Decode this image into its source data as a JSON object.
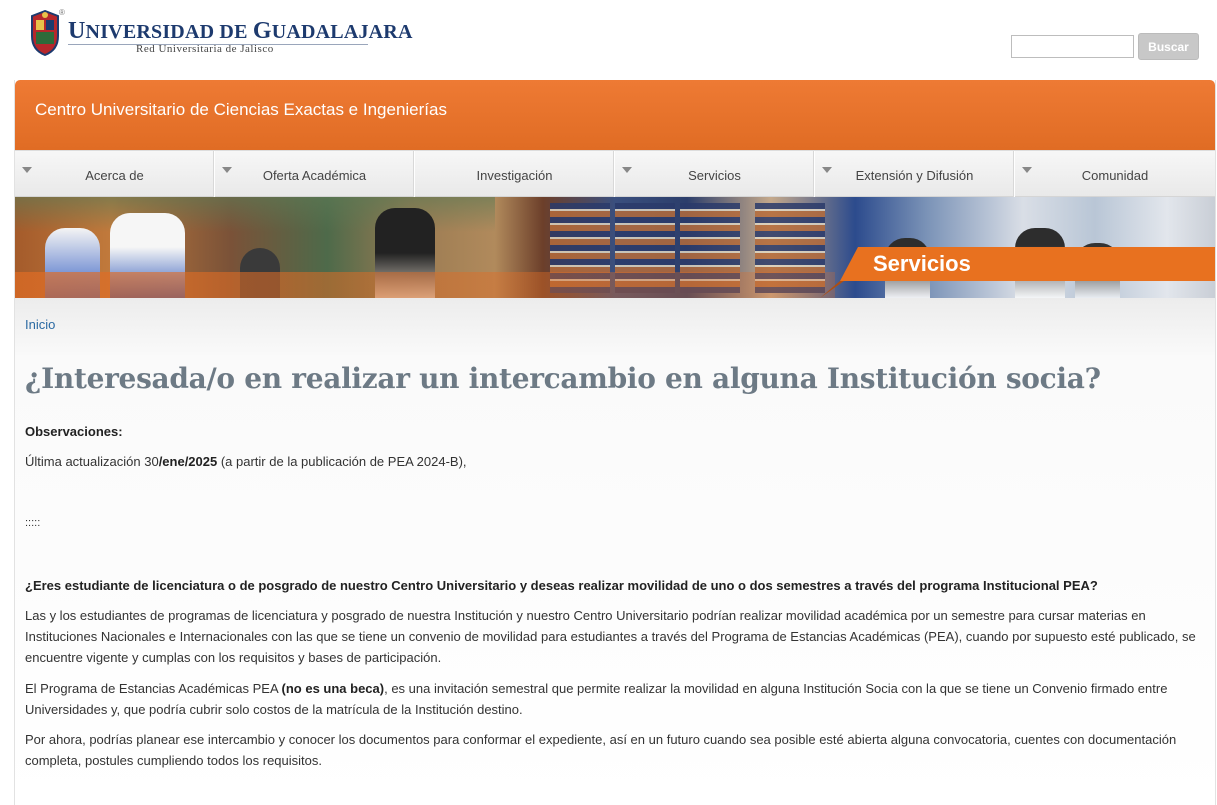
{
  "brand": {
    "title_prefix_big": "U",
    "title_part1": "NIVERSIDAD DE ",
    "title_prefix_big2": "G",
    "title_part2": "UADALAJARA",
    "subtitle": "Red Universitaria de Jalisco",
    "registered": "®"
  },
  "search": {
    "value": "",
    "button_label": "Buscar"
  },
  "header": {
    "title": "Centro Universitario de Ciencias Exactas e Ingenierías"
  },
  "nav": {
    "items": [
      {
        "label": "Acerca de",
        "has_dropdown": true
      },
      {
        "label": "Oferta Académica",
        "has_dropdown": true
      },
      {
        "label": "Investigación",
        "has_dropdown": false
      },
      {
        "label": "Servicios",
        "has_dropdown": true
      },
      {
        "label": "Extensión y Difusión",
        "has_dropdown": true
      },
      {
        "label": "Comunidad",
        "has_dropdown": true
      }
    ]
  },
  "banner": {
    "section_label": "Servicios"
  },
  "breadcrumb": {
    "home": "Inicio"
  },
  "article": {
    "title": "¿Interesada/o en realizar un intercambio en alguna Institución socia?",
    "obs_label": "Observaciones:",
    "update_prefix": "Última actualización 30",
    "update_bold": "/ene/2025",
    "update_suffix": " (a partir de la publicación de PEA 2024-B),",
    "separator": ":::::",
    "question": "¿Eres estudiante de licenciatura o de posgrado de nuestro Centro Universitario y deseas realizar movilidad de uno o dos semestres a través del programa Institucional PEA?",
    "p1": "Las y los estudiantes de programas de licenciatura y posgrado de nuestra Institución y nuestro Centro Universitario podrían realizar movilidad académica por un semestre para cursar materias en Instituciones Nacionales e Internacionales con las que se tiene un convenio de movilidad para estudiantes a través del Programa de Estancias Académicas (PEA), cuando por supuesto esté publicado, se encuentre vigente y cumplas con los requisitos y bases de participación.",
    "p2_prefix": "El Programa de Estancias Académicas  PEA ",
    "p2_bold": "(no es una beca)",
    "p2_suffix": ", es una invitación semestral que permite realizar la movilidad en alguna Institución Socia con la que se tiene un Convenio firmado entre Universidades y, que podría cubrir solo costos de la matrícula de la Institución destino.",
    "p3": "Por ahora, podrías planear ese intercambio y conocer los documentos para conformar el expediente, así en un futuro cuando sea posible esté abierta alguna convocatoria, cuentes con documentación completa, postules cumpliendo todos los requisitos."
  },
  "colors": {
    "brand_orange": "#e8711f",
    "brand_navy": "#1d3a6e",
    "link_blue": "#2b6aa3",
    "title_gray": "#6d7a85"
  }
}
